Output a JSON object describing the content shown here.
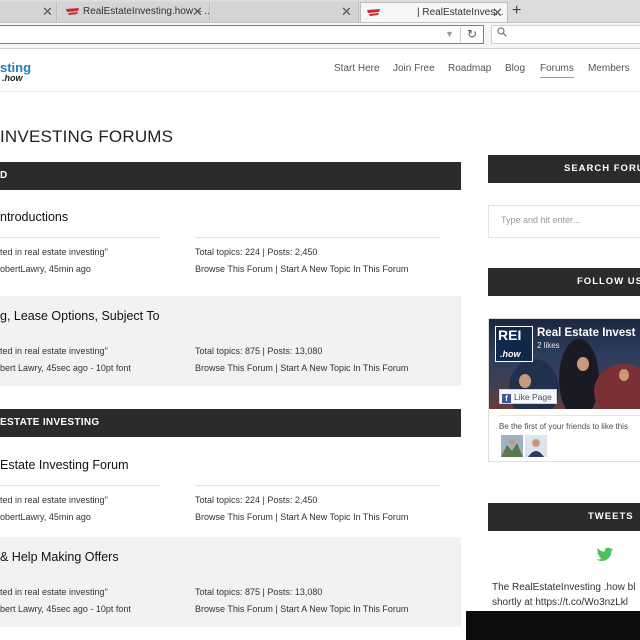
{
  "browser": {
    "tabs": [
      {
        "title": "",
        "state": "inactive"
      },
      {
        "title": "RealEstateInvesting.how – ...",
        "state": "inactive"
      },
      {
        "title": "| RealEstateInves...",
        "state": "active"
      }
    ],
    "close_glyph": "✕",
    "new_tab_glyph": "+",
    "reload_glyph": "↻",
    "url_dropdown_glyph": "▼",
    "search_glyph": "⚲",
    "url": "",
    "search_value": ""
  },
  "site": {
    "logo_top": "sting",
    "logo_bottom": ".how",
    "nav": [
      "Start Here",
      "Join Free",
      "Roadmap",
      "Blog",
      "Forums",
      "Members"
    ],
    "active_nav": "Forums"
  },
  "page": {
    "title": "INVESTING FORUMS",
    "sections": [
      {
        "label": "D",
        "forums": [
          {
            "name": "ntroductions",
            "left_line1": "ted in real estate investing\"",
            "left_line2": "obertLawry, 45min ago",
            "right_line1": "Total topics: 224 | Posts: 2,450",
            "right_line2": "Browse This Forum | Start A New Topic In This Forum"
          },
          {
            "name": "g, Lease Options, Subject To",
            "left_line1": "ted in real estate investing\"",
            "left_line2": "bert Lawry, 45sec ago - 10pt font",
            "right_line1": "Total topics: 875 | Posts: 13,080",
            "right_line2": "Browse This Forum | Start A New Topic In This Forum"
          }
        ]
      },
      {
        "label": "ESTATE INVESTING",
        "forums": [
          {
            "name": "Estate Investing Forum",
            "left_line1": "ted in real estate investing\"",
            "left_line2": "obertLawry, 45min ago",
            "right_line1": "Total topics: 224 | Posts: 2,450",
            "right_line2": "Browse This Forum | Start A New Topic In This Forum"
          },
          {
            "name": "& Help Making Offers",
            "left_line1": "ted in real estate investing\"",
            "left_line2": "bert Lawry, 45sec ago - 10pt font",
            "right_line1": "Total topics: 875 | Posts: 13,080",
            "right_line2": "Browse This Forum | Start A New Topic In This Forum"
          }
        ]
      }
    ]
  },
  "sidebar": {
    "search_heading": "SEARCH FORU",
    "search_placeholder": "Type and hit enter...",
    "follow_heading": "FOLLOW US",
    "fb_page_name": "Real Estate Invest",
    "fb_logo_top": "REI",
    "fb_logo_bottom": ".how",
    "fb_likes": "2 likes",
    "fb_like_button": "Like Page",
    "fb_f": "f",
    "fb_first_friends": "Be the first of your friends to like this",
    "tweets_heading": "TWEETS",
    "tweet_line1": "The RealEstateInvesting .how bl",
    "tweet_line2": "shortly at https://t.co/Wo3nzLkl"
  },
  "colors": {
    "dark_bar": "#2b2b2b",
    "link_blue": "#1e7fc6",
    "twitter": "#4cc05a",
    "url_focus": "#3b8fd6"
  }
}
